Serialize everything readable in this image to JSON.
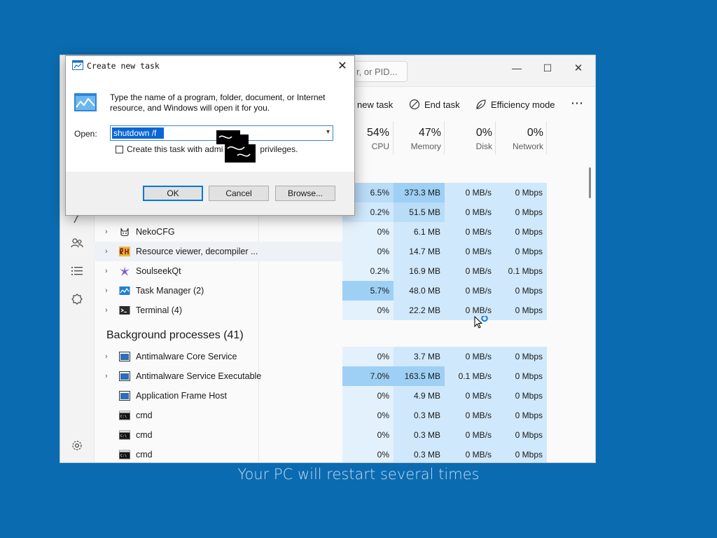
{
  "task_manager": {
    "search_placeholder": "r, or PID...",
    "toolbar": {
      "new_task": "new task",
      "end_task": "End task",
      "efficiency_mode": "Efficiency mode",
      "more": "⋯"
    },
    "columns": [
      {
        "pct": "54%",
        "label": "CPU"
      },
      {
        "pct": "47%",
        "label": "Memory"
      },
      {
        "pct": "0%",
        "label": "Disk"
      },
      {
        "pct": "0%",
        "label": "Network"
      }
    ],
    "apps_rows": [
      {
        "name": "",
        "cpu": "6.5%",
        "mem": "373.3 MB",
        "disk": "0 MB/s",
        "net": "0 Mbps"
      },
      {
        "name": "",
        "cpu": "0.2%",
        "mem": "51.5 MB",
        "disk": "0 MB/s",
        "net": "0 Mbps"
      },
      {
        "name": "NekoCFG",
        "cpu": "0%",
        "mem": "6.1 MB",
        "disk": "0 MB/s",
        "net": "0 Mbps"
      },
      {
        "name": "Resource viewer, decompiler ...",
        "cpu": "0%",
        "mem": "14.7 MB",
        "disk": "0 MB/s",
        "net": "0 Mbps"
      },
      {
        "name": "SoulseekQt",
        "cpu": "0.2%",
        "mem": "16.9 MB",
        "disk": "0 MB/s",
        "net": "0.1 Mbps"
      },
      {
        "name": "Task Manager (2)",
        "cpu": "5.7%",
        "mem": "48.0 MB",
        "disk": "0 MB/s",
        "net": "0 Mbps"
      },
      {
        "name": "Terminal (4)",
        "cpu": "0%",
        "mem": "22.2 MB",
        "disk": "0 MB/s",
        "net": "0 Mbps"
      }
    ],
    "background_title": "Background processes (41)",
    "background_rows": [
      {
        "name": "Antimalware Core Service",
        "cpu": "0%",
        "mem": "3.7 MB",
        "disk": "0 MB/s",
        "net": "0 Mbps"
      },
      {
        "name": "Antimalware Service Executable",
        "cpu": "7.0%",
        "mem": "163.5 MB",
        "disk": "0.1 MB/s",
        "net": "0 Mbps"
      },
      {
        "name": "Application Frame Host",
        "cpu": "0%",
        "mem": "4.9 MB",
        "disk": "0 MB/s",
        "net": "0 Mbps"
      },
      {
        "name": "cmd",
        "cpu": "0%",
        "mem": "0.3 MB",
        "disk": "0 MB/s",
        "net": "0 Mbps"
      },
      {
        "name": "cmd",
        "cpu": "0%",
        "mem": "0.3 MB",
        "disk": "0 MB/s",
        "net": "0 Mbps"
      },
      {
        "name": "cmd",
        "cpu": "0%",
        "mem": "0.3 MB",
        "disk": "0 MB/s",
        "net": "0 Mbps"
      }
    ]
  },
  "dialog": {
    "title": "Create new task",
    "description": "Type the name of a program, folder, document, or Internet resource, and Windows will open it for you.",
    "open_label": "Open:",
    "open_value": "shutdown /f",
    "checkbox_label": "Create this task with admi",
    "checkbox_label_tail": "privileges.",
    "ok": "OK",
    "cancel": "Cancel",
    "browse": "Browse..."
  },
  "caption": "Your PC will restart several times"
}
